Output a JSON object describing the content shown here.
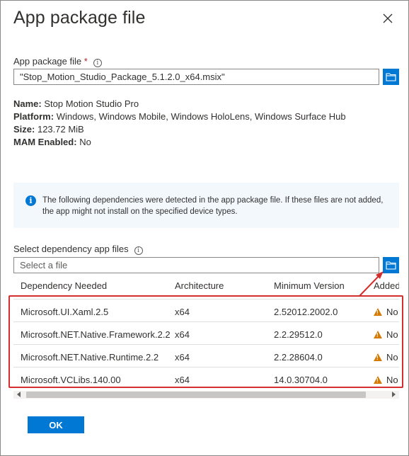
{
  "dialog": {
    "title": "App package file"
  },
  "package_field": {
    "label": "App package file",
    "required_marker": "*",
    "value": "\"Stop_Motion_Studio_Package_5.1.2.0_x64.msix\""
  },
  "package_info": {
    "name_label": "Name:",
    "name_value": "Stop Motion Studio Pro",
    "platform_label": "Platform:",
    "platform_value": "Windows, Windows Mobile, Windows HoloLens, Windows Surface Hub",
    "size_label": "Size:",
    "size_value": "123.72 MiB",
    "mam_label": "MAM Enabled:",
    "mam_value": "No"
  },
  "notice": {
    "text": "The following dependencies were detected in the app package file. If these files are not added, the app might not install on the specified device types."
  },
  "dependency_field": {
    "label": "Select dependency app files",
    "placeholder": "Select a file"
  },
  "table": {
    "headers": [
      "Dependency Needed",
      "Architecture",
      "Minimum Version",
      "Added"
    ],
    "rows": [
      {
        "name": "Microsoft.UI.Xaml.2.5",
        "arch": "x64",
        "version": "2.52012.2002.0",
        "added": "No"
      },
      {
        "name": "Microsoft.NET.Native.Framework.2.2",
        "arch": "x64",
        "version": "2.2.29512.0",
        "added": "No"
      },
      {
        "name": "Microsoft.NET.Native.Runtime.2.2",
        "arch": "x64",
        "version": "2.2.28604.0",
        "added": "No"
      },
      {
        "name": "Microsoft.VCLibs.140.00",
        "arch": "x64",
        "version": "14.0.30704.0",
        "added": "No"
      }
    ]
  },
  "footer": {
    "ok_label": "OK"
  },
  "colors": {
    "accent": "#0078d4",
    "warning": "#d47a00",
    "highlight": "#d32f2f",
    "notice_bg": "#f3f8fd"
  },
  "icons": {
    "close": "close-icon",
    "info": "info-icon",
    "folder": "folder-icon",
    "warning": "warning-icon",
    "notice": "info-circle-icon"
  }
}
